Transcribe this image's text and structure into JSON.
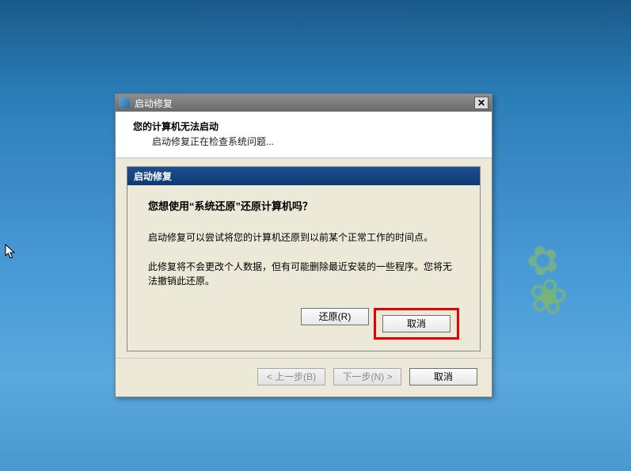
{
  "outer": {
    "title": "启动修复",
    "header_title": "您的计算机无法启动",
    "header_sub": "启动修复正在检查系统问题...",
    "btn_back": "< 上一步(B)",
    "btn_next": "下一步(N) >",
    "btn_cancel": "取消"
  },
  "inner": {
    "title": "启动修复",
    "question": "您想使用“系统还原”还原计算机吗？",
    "para1": "启动修复可以尝试将您的计算机还原到以前某个正常工作的时间点。",
    "para2": "此修复将不会更改个人数据，但有可能删除最近安装的一些程序。您将无法撤销此还原。",
    "btn_restore": "还原(R)",
    "btn_cancel": "取消"
  }
}
